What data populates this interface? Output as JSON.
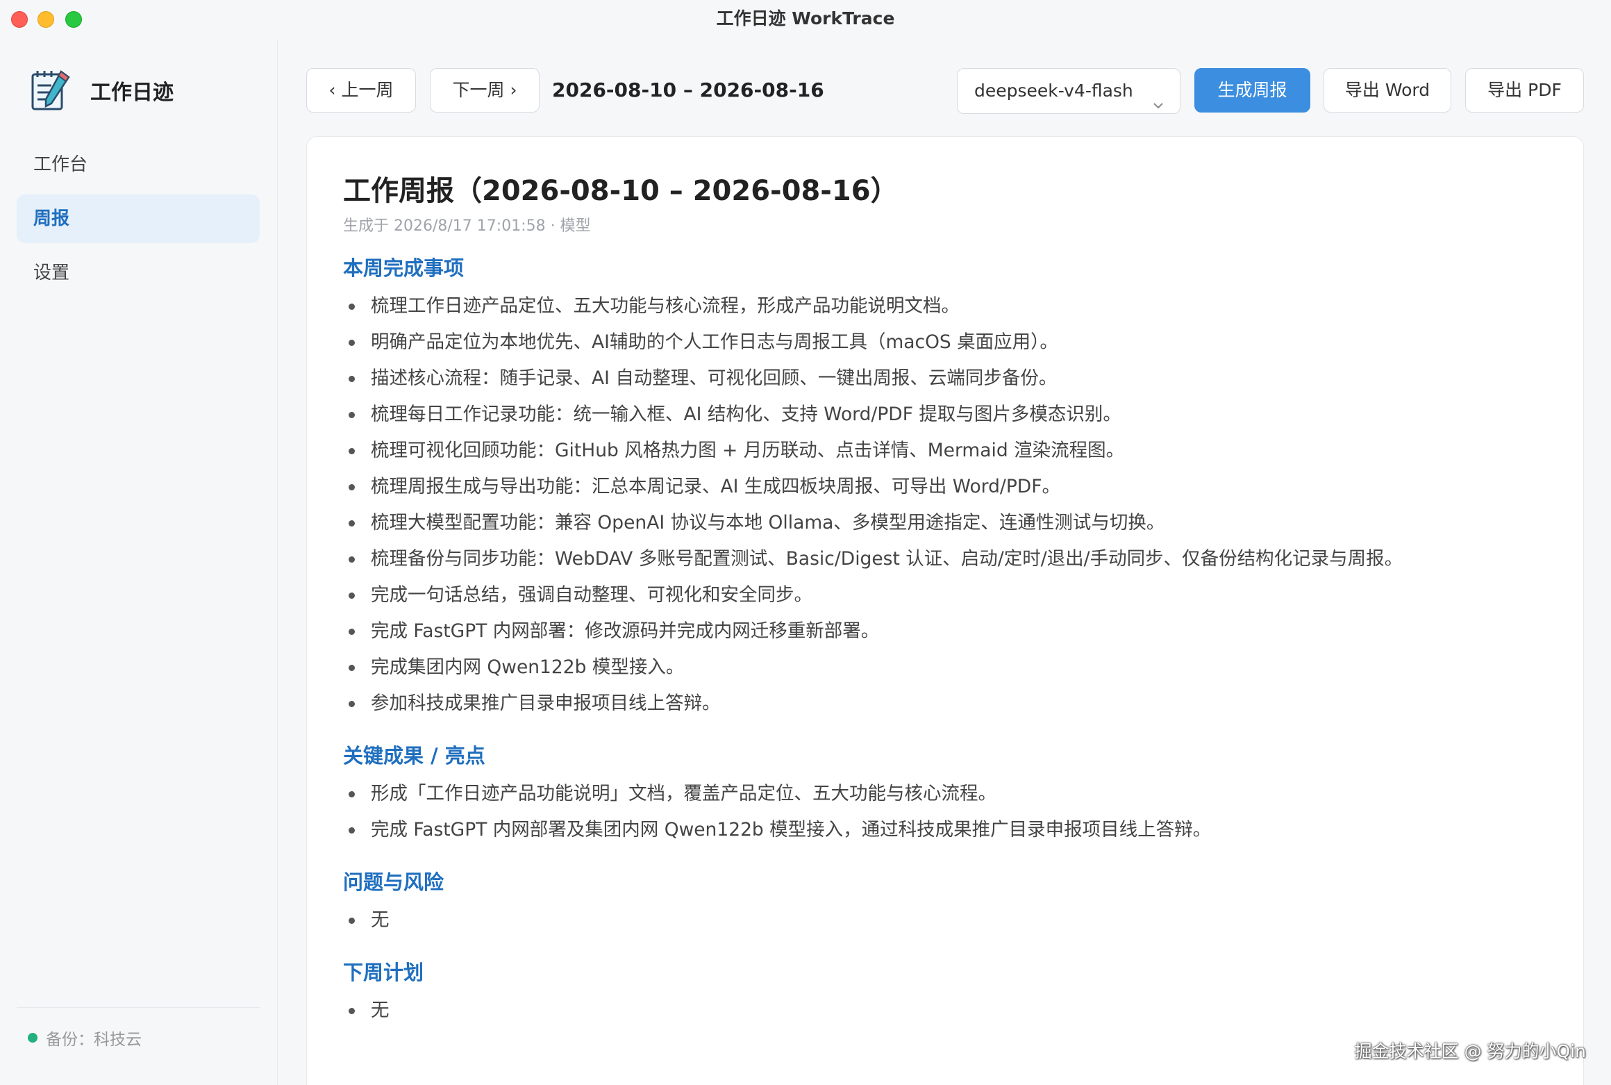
{
  "window": {
    "title": "工作日迹 WorkTrace"
  },
  "sidebar": {
    "brand": "工作日迹",
    "items": [
      {
        "label": "工作台",
        "active": false
      },
      {
        "label": "周报",
        "active": true
      },
      {
        "label": "设置",
        "active": false
      }
    ],
    "footer": "备份：科技云"
  },
  "toolbar": {
    "prev_label": "‹ 上一周",
    "next_label": "下一周 ›",
    "range": "2026-08-10 – 2026-08-16",
    "model_selected": "deepseek-v4-flash",
    "generate_label": "生成周报",
    "export_word_label": "导出 Word",
    "export_pdf_label": "导出 PDF"
  },
  "report": {
    "title": "工作周报（2026-08-10 – 2026-08-16）",
    "meta": "生成于 2026/8/17 17:01:58 · 模型",
    "sections": [
      {
        "title": "本周完成事项",
        "items": [
          "梳理工作日迹产品定位、五大功能与核心流程，形成产品功能说明文档。",
          "明确产品定位为本地优先、AI辅助的个人工作日志与周报工具（macOS 桌面应用）。",
          "描述核心流程：随手记录、AI 自动整理、可视化回顾、一键出周报、云端同步备份。",
          "梳理每日工作记录功能：统一输入框、AI 结构化、支持 Word/PDF 提取与图片多模态识别。",
          "梳理可视化回顾功能：GitHub 风格热力图 + 月历联动、点击详情、Mermaid 渲染流程图。",
          "梳理周报生成与导出功能：汇总本周记录、AI 生成四板块周报、可导出 Word/PDF。",
          "梳理大模型配置功能：兼容 OpenAI 协议与本地 Ollama、多模型用途指定、连通性测试与切换。",
          "梳理备份与同步功能：WebDAV 多账号配置测试、Basic/Digest 认证、启动/定时/退出/手动同步、仅备份结构化记录与周报。",
          "完成一句话总结，强调自动整理、可视化和安全同步。",
          "完成 FastGPT 内网部署：修改源码并完成内网迁移重新部署。",
          "完成集团内网 Qwen122b 模型接入。",
          "参加科技成果推广目录申报项目线上答辩。"
        ]
      },
      {
        "title": "关键成果 / 亮点",
        "items": [
          "形成「工作日迹产品功能说明」文档，覆盖产品定位、五大功能与核心流程。",
          "完成 FastGPT 内网部署及集团内网 Qwen122b 模型接入，通过科技成果推广目录申报项目线上答辩。"
        ]
      },
      {
        "title": "问题与风险",
        "items": [
          "无"
        ]
      },
      {
        "title": "下周计划",
        "items": [
          "无"
        ]
      }
    ]
  },
  "watermark": "掘金技术社区 @ 努力的小Qin",
  "colors": {
    "accent": "#3c8ee0",
    "section_title": "#1f6fbf",
    "nav_active_bg": "#e6f0fa",
    "status_ok": "#22b07d"
  }
}
